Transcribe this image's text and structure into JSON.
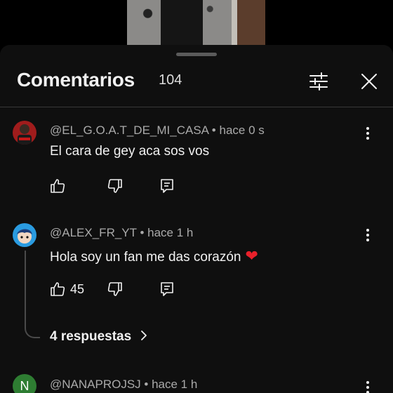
{
  "header": {
    "title": "Comentarios",
    "count": "104"
  },
  "comments": [
    {
      "author": "@EL_G.O.A.T_DE_MI_CASA",
      "time": "hace 0 s",
      "text": "El cara de gey aca sos vos",
      "likes": ""
    },
    {
      "author": "@ALEX_FR_YT",
      "time": "hace 1 h",
      "text": "Hola soy un fan me das corazón",
      "likes": "45",
      "replies": "4 respuestas"
    },
    {
      "author": "@NANAPROJSJ",
      "time": "hace 1 h",
      "avatar_initial": "N"
    }
  ],
  "colors": {
    "sheet_bg": "#0f0f0f",
    "text": "#f1f1f1",
    "meta": "#aaaaaa",
    "heart": "#e8202a",
    "avatar_n_bg": "#2e7d32"
  },
  "icons": {
    "filter": "sliders-icon",
    "close": "close-icon",
    "like": "thumb-up-icon",
    "dislike": "thumb-down-icon",
    "reply": "comment-reply-icon",
    "more": "more-vertical-icon",
    "chevron": "chevron-right-icon"
  }
}
